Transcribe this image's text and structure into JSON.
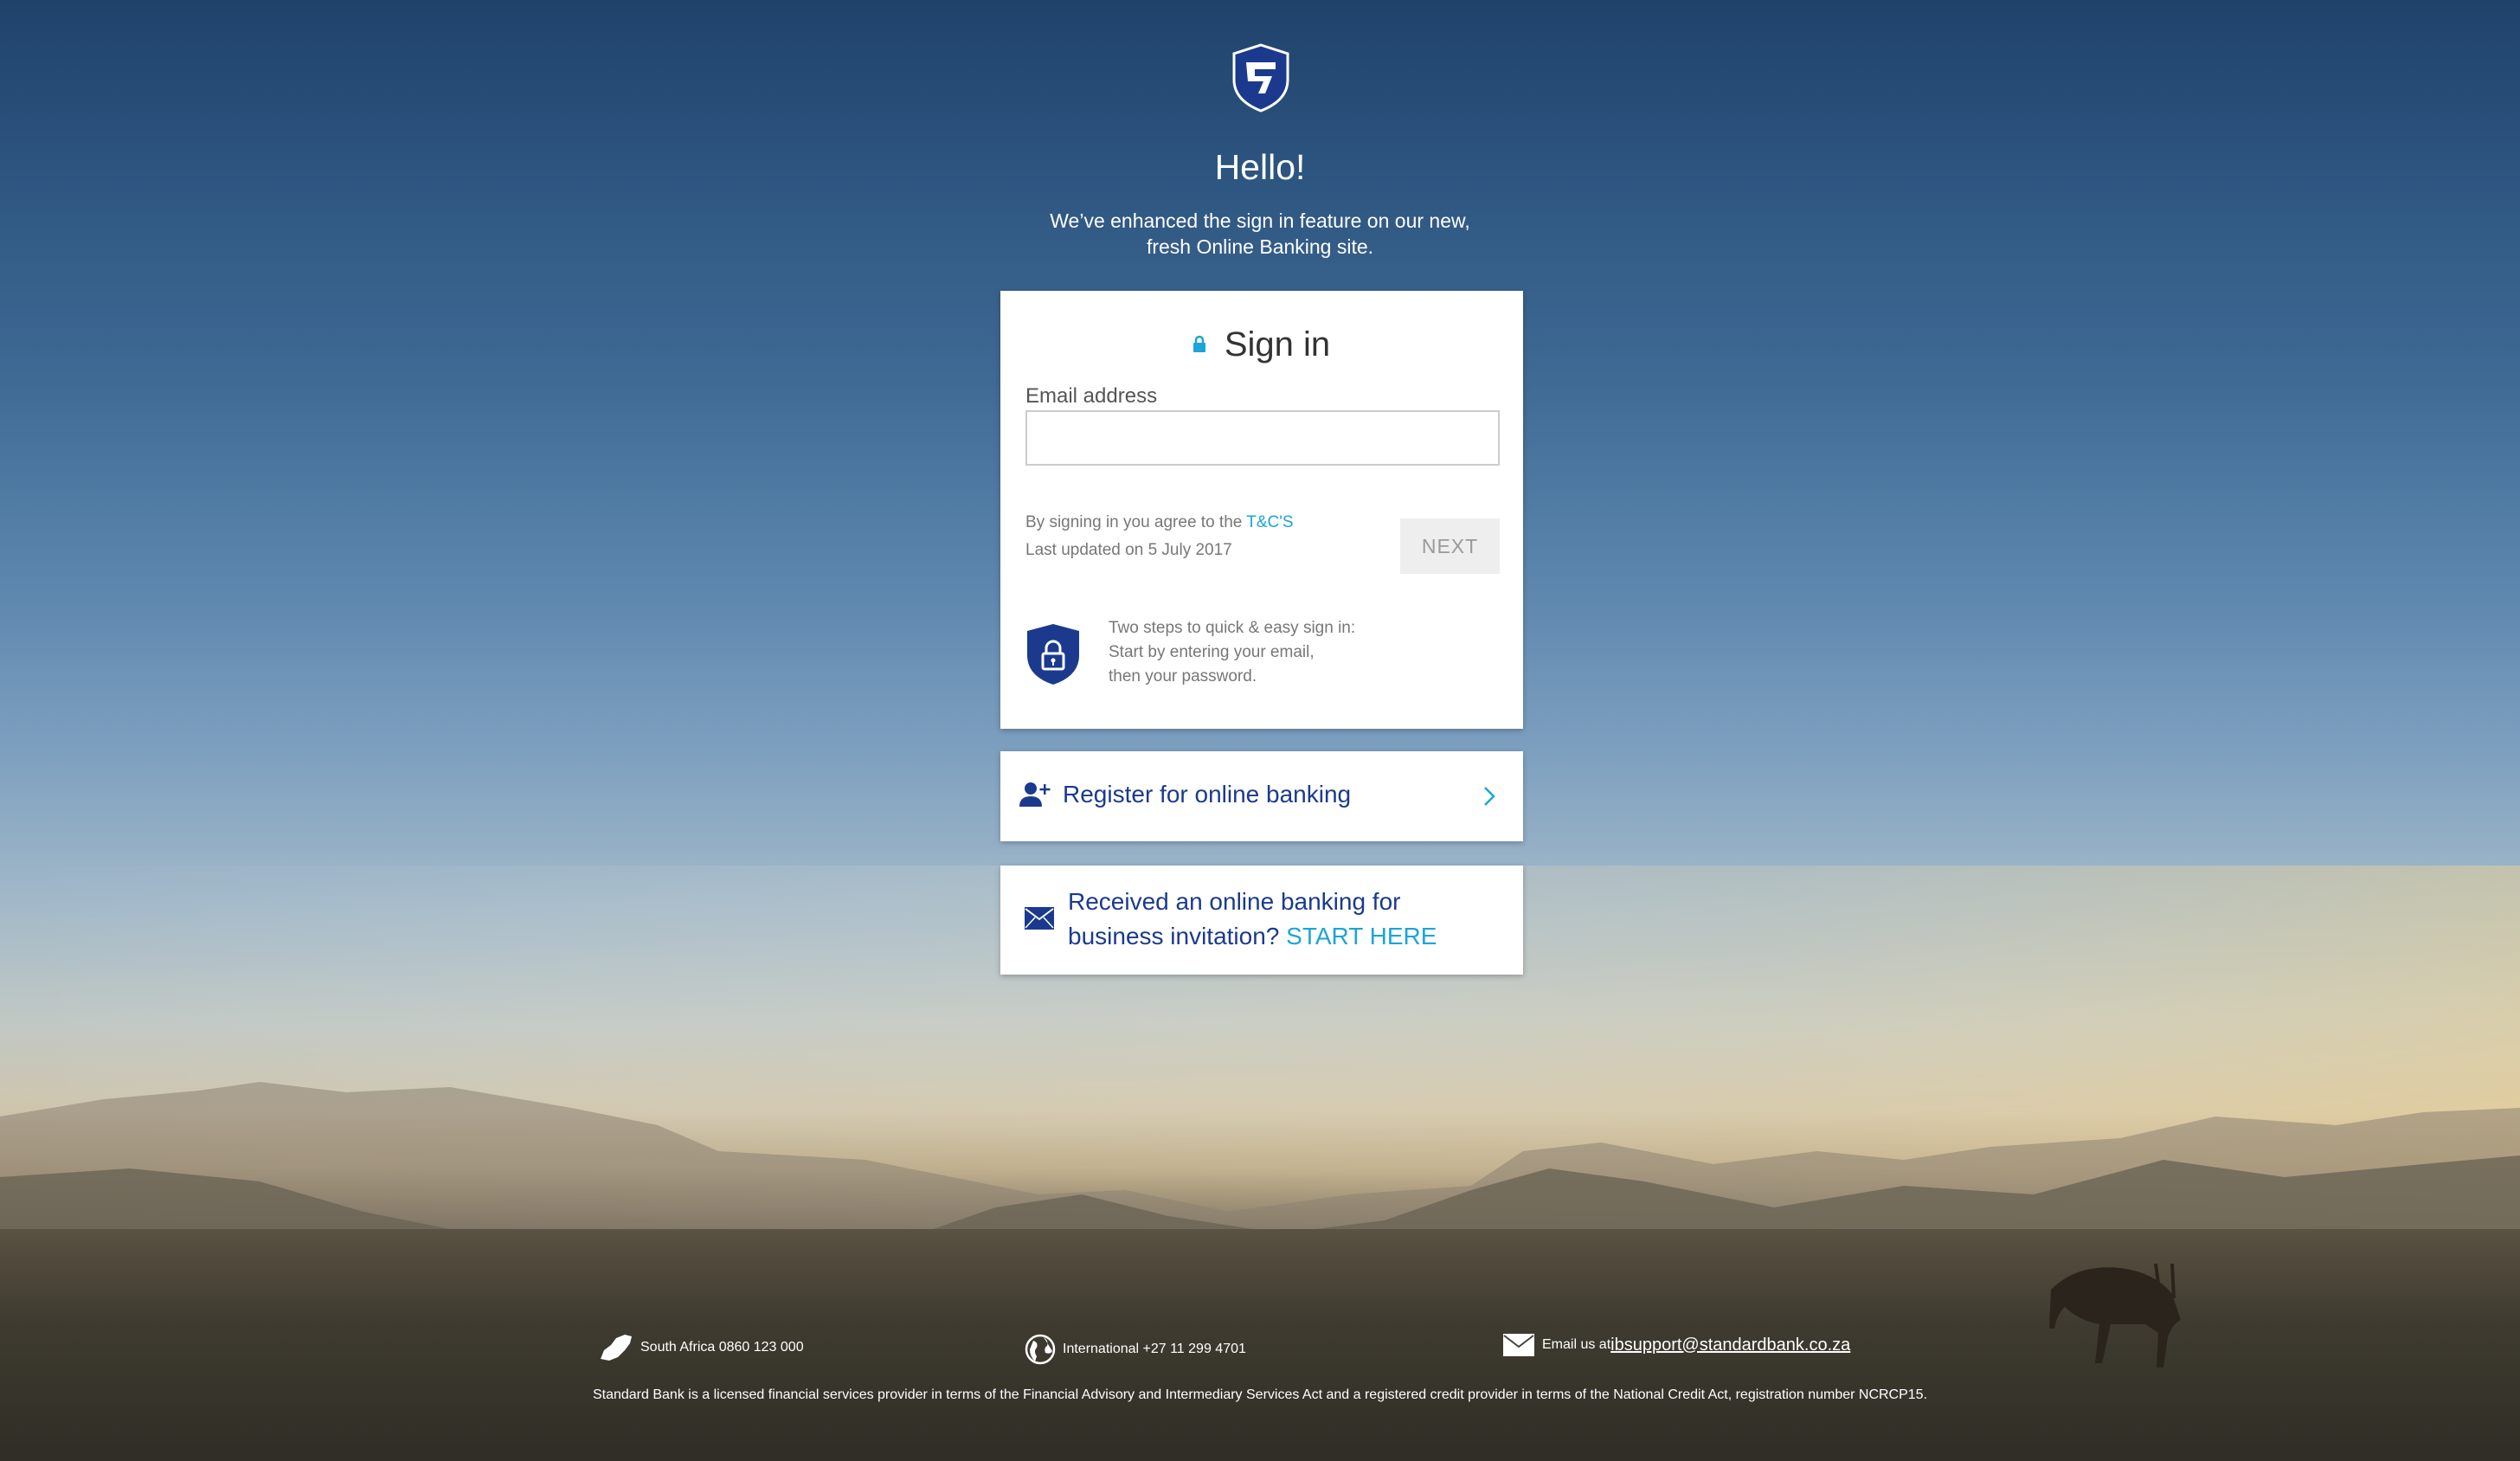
{
  "header": {
    "greeting": "Hello!",
    "intro_line1": "We’ve enhanced the sign in feature on our new,",
    "intro_line2": "fresh Online Banking site."
  },
  "signin": {
    "title": "Sign in",
    "email_label": "Email address",
    "email_value": "",
    "terms_prefix": "By signing in you agree to the ",
    "terms_link": "T&C'S",
    "last_updated": "Last updated on 5 July 2017",
    "next_label": "NEXT",
    "steps_line1": "Two steps to quick & easy sign in:",
    "steps_line2": "Start by entering your email,",
    "steps_line3": "then your password."
  },
  "register": {
    "label": "Register for online banking"
  },
  "invite": {
    "line1": "Received an online banking for",
    "line2_prefix": "business invitation? ",
    "link": "START HERE"
  },
  "footer": {
    "sa_phone": "South Africa 0860 123 000",
    "intl_phone": "International +27 11 299 4701",
    "email_prefix": "Email us at ",
    "email_link": "ibsupport@standardbank.co.za",
    "legal": "Standard Bank is a licensed financial services provider in terms of the Financial Advisory and Intermediary Services Act and a registered credit provider in terms of the National Credit Act, registration number NCRCP15."
  },
  "colors": {
    "brand_blue": "#1b3a8e",
    "link_cyan": "#1ba5d8"
  },
  "icons": [
    "bank-shield-logo",
    "lock-icon",
    "security-shield-icon",
    "add-user-icon",
    "chevron-right-icon",
    "envelope-icon",
    "south-africa-map-icon",
    "globe-icon"
  ]
}
